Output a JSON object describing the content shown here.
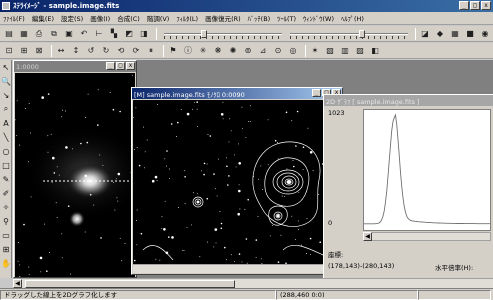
{
  "app": {
    "title": "ｽﾃﾗｲﾒｰｼﾞ - sample.image.fits"
  },
  "window_controls": {
    "minimize": "_",
    "maximize": "□",
    "close": "x"
  },
  "menu": [
    "ﾌｧｲﾙ(F)",
    "編集(E)",
    "設定(S)",
    "画像(I)",
    "合成(C)",
    "階調(V)",
    "ﾌｨﾙﾀ(L)",
    "画像復元(R)",
    "ﾊﾞｯﾁ(B)",
    "ﾂｰﾙ(T)",
    "ｳｨﾝﾄﾞｳ(W)",
    "ﾍﾙﾌﾟ(H)"
  ],
  "toolbar1": {
    "icons": [
      "open-icon",
      "save-icon",
      "print-icon",
      "copy-icon",
      "paste-icon",
      "undo-icon",
      "level-icon",
      "histogram-icon",
      "gamma-icon",
      "contrast-icon"
    ],
    "glyphs": [
      "▤",
      "▦",
      "⎙",
      "⧉",
      "▣",
      "↶",
      "⊢",
      "▚",
      "◩",
      "◨"
    ],
    "slider_left_value": 0.33,
    "slider_right_value": 0.62,
    "right_icons": [
      "bw-icon",
      "negative-icon",
      "grid-icon",
      "rgb-icon",
      "zoom-icon",
      "palette-icon"
    ],
    "right_glyphs": [
      "◪",
      "◆",
      "▦",
      "■",
      "◉",
      "▩"
    ]
  },
  "toolbar2": {
    "icons": [
      "scale-icon",
      "fit-icon",
      "zoom-fit-icon",
      "flip-h-icon",
      "flip-v-icon",
      "rotate-ccw-icon",
      "rotate-cw-icon",
      "rotate-180-icon",
      "rotate-any-icon",
      "pause-icon",
      "marker-icon",
      "info-icon",
      "star-icon",
      "nebula-icon",
      "galaxy-icon",
      "stack-icon",
      "measure-icon",
      "photometry-icon",
      "contour-icon",
      "sharpen-icon",
      "blink-icon",
      "tile-icon",
      "cascade-icon",
      "window-icon"
    ],
    "glyphs": [
      "⊡",
      "⊞",
      "⊠",
      "↔",
      "↕",
      "↺",
      "↻",
      "⟲",
      "⟳",
      "⏸",
      "⚑",
      "ⓘ",
      "✳",
      "❋",
      "✺",
      "⊚",
      "⊿",
      "⊙",
      "◎",
      "✶",
      "▧",
      "▥",
      "▨",
      "◧"
    ]
  },
  "palette": {
    "icons": [
      "select-arrow-icon",
      "zoom-tool-icon",
      "pick-icon",
      "magnify-icon",
      "text-tool-icon",
      "line-tool-icon",
      "ellipse-tool-icon",
      "rect-tool-icon",
      "pen-tool-icon",
      "eyedropper-icon",
      "fill-tool-icon",
      "stamp-icon",
      "coordinates-icon",
      "grid-tool-icon",
      "pan-tool-icon"
    ],
    "glyphs": [
      "↖",
      "🔍",
      "↘",
      "⌕",
      "A",
      "╲",
      "○",
      "□",
      "✎",
      "✐",
      "✧",
      "⚲",
      "▭",
      "⊞",
      "✋"
    ]
  },
  "windows": {
    "left": {
      "title": "1:0000",
      "btn_min": "_",
      "btn_max": "□",
      "btn_close": "x"
    },
    "middle": {
      "title": "[M] sample.image.fits ﾓﾉｸﾛ 0:0090",
      "btn_min": "_",
      "btn_max": "□",
      "btn_close": "x"
    },
    "graph": {
      "title": "2D ｸﾞﾗﾌ [ sample.image.fits ]",
      "ymax": "1023",
      "ymin": "0",
      "coord_label": "座標:",
      "coord_value": "(178,143)-(280,143)",
      "ratio_label": "水平倍率(H):"
    }
  },
  "graph_profile": {
    "peak_position": 0.24,
    "peak_value": 0.98,
    "baseline": 0.02
  },
  "status": {
    "hint": "ドラッグした線上を2Dグラフ化します",
    "pixel_info": "(288,460 0:0)",
    "extra": ""
  },
  "colors": {
    "title_active": "#0a246a",
    "title_active_end": "#3a6ea5",
    "face": "#d4d0c8",
    "mdi_background": "#808080"
  }
}
